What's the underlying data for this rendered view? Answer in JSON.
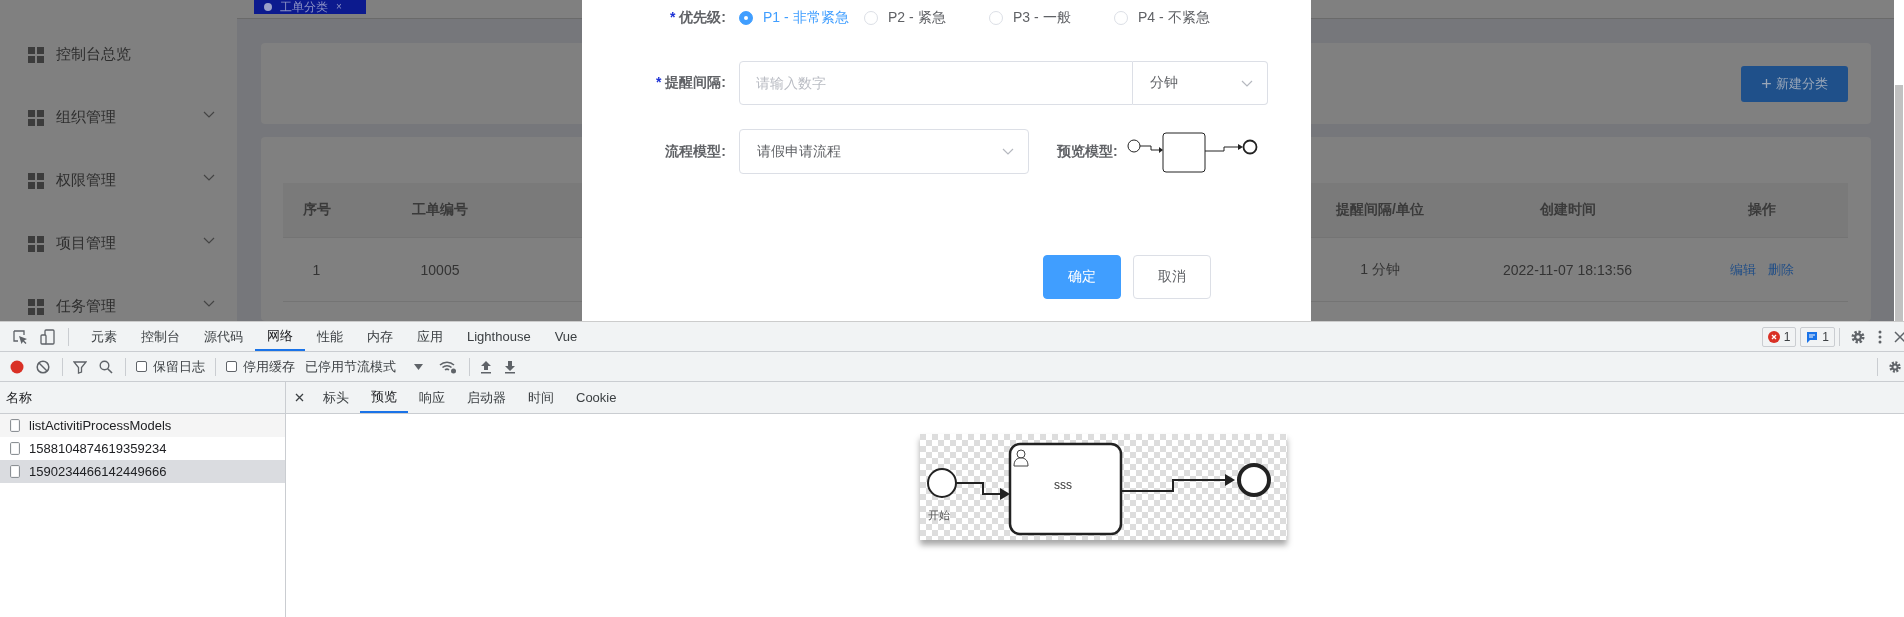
{
  "app": {
    "page_tab": {
      "label": "工单分类",
      "close": "×"
    },
    "sidebar": {
      "items": [
        {
          "label": "控制台总览",
          "expandable": false
        },
        {
          "label": "组织管理",
          "expandable": true
        },
        {
          "label": "权限管理",
          "expandable": true
        },
        {
          "label": "项目管理",
          "expandable": true
        },
        {
          "label": "任务管理",
          "expandable": true
        }
      ]
    },
    "new_button": {
      "icon": "+",
      "label": "新建分类"
    },
    "table": {
      "columns": [
        "序号",
        "工单编号",
        "提醒间隔/单位",
        "创建时间",
        "操作"
      ],
      "rows": [
        {
          "cells": [
            "1",
            "10005",
            "1 分钟",
            "2022-11-07 18:13:56"
          ],
          "actions": [
            "编辑",
            "删除"
          ]
        }
      ]
    }
  },
  "dialog": {
    "priority": {
      "label": "优先级:",
      "required_mark": "*",
      "options": [
        {
          "label": "P1 - 非常紧急",
          "selected": true
        },
        {
          "label": "P2 - 紧急",
          "selected": false
        },
        {
          "label": "P3 - 一般",
          "selected": false
        },
        {
          "label": "P4 - 不紧急",
          "selected": false
        }
      ]
    },
    "interval": {
      "label": "提醒间隔:",
      "required_mark": "*",
      "placeholder": "请输入数字",
      "unit": "分钟"
    },
    "process_model": {
      "label": "流程模型:",
      "value": "请假申请流程"
    },
    "preview": {
      "label": "预览模型:"
    },
    "buttons": [
      {
        "label": "确定",
        "kind": "primary"
      },
      {
        "label": "取消",
        "kind": "default"
      }
    ]
  },
  "devtools": {
    "tabs": [
      {
        "label": "元素",
        "selected": false
      },
      {
        "label": "控制台",
        "selected": false
      },
      {
        "label": "源代码",
        "selected": false
      },
      {
        "label": "网络",
        "selected": true
      },
      {
        "label": "性能",
        "selected": false
      },
      {
        "label": "内存",
        "selected": false
      },
      {
        "label": "应用",
        "selected": false
      },
      {
        "label": "Lighthouse",
        "selected": false
      },
      {
        "label": "Vue",
        "selected": false
      }
    ],
    "error_count": "1",
    "message_count": "1",
    "toolbar": {
      "preserve_log": {
        "label": "保留日志",
        "checked": false
      },
      "disable_cache": {
        "label": "停用缓存",
        "checked": false
      },
      "throttling": "已停用节流模式"
    },
    "requests": {
      "header": "名称",
      "items": [
        {
          "name": "listActivitiProcessModels",
          "selected": false
        },
        {
          "name": "1588104874619359234",
          "selected": false
        },
        {
          "name": "1590234466142449666",
          "selected": true
        }
      ]
    },
    "detail_tabs": [
      {
        "label": "标头",
        "selected": false
      },
      {
        "label": "预览",
        "selected": true
      },
      {
        "label": "响应",
        "selected": false
      },
      {
        "label": "启动器",
        "selected": false
      },
      {
        "label": "时间",
        "selected": false
      },
      {
        "label": "Cookie",
        "selected": false
      }
    ],
    "preview_image": {
      "start_label": "开始",
      "task_label": "sss"
    }
  }
}
